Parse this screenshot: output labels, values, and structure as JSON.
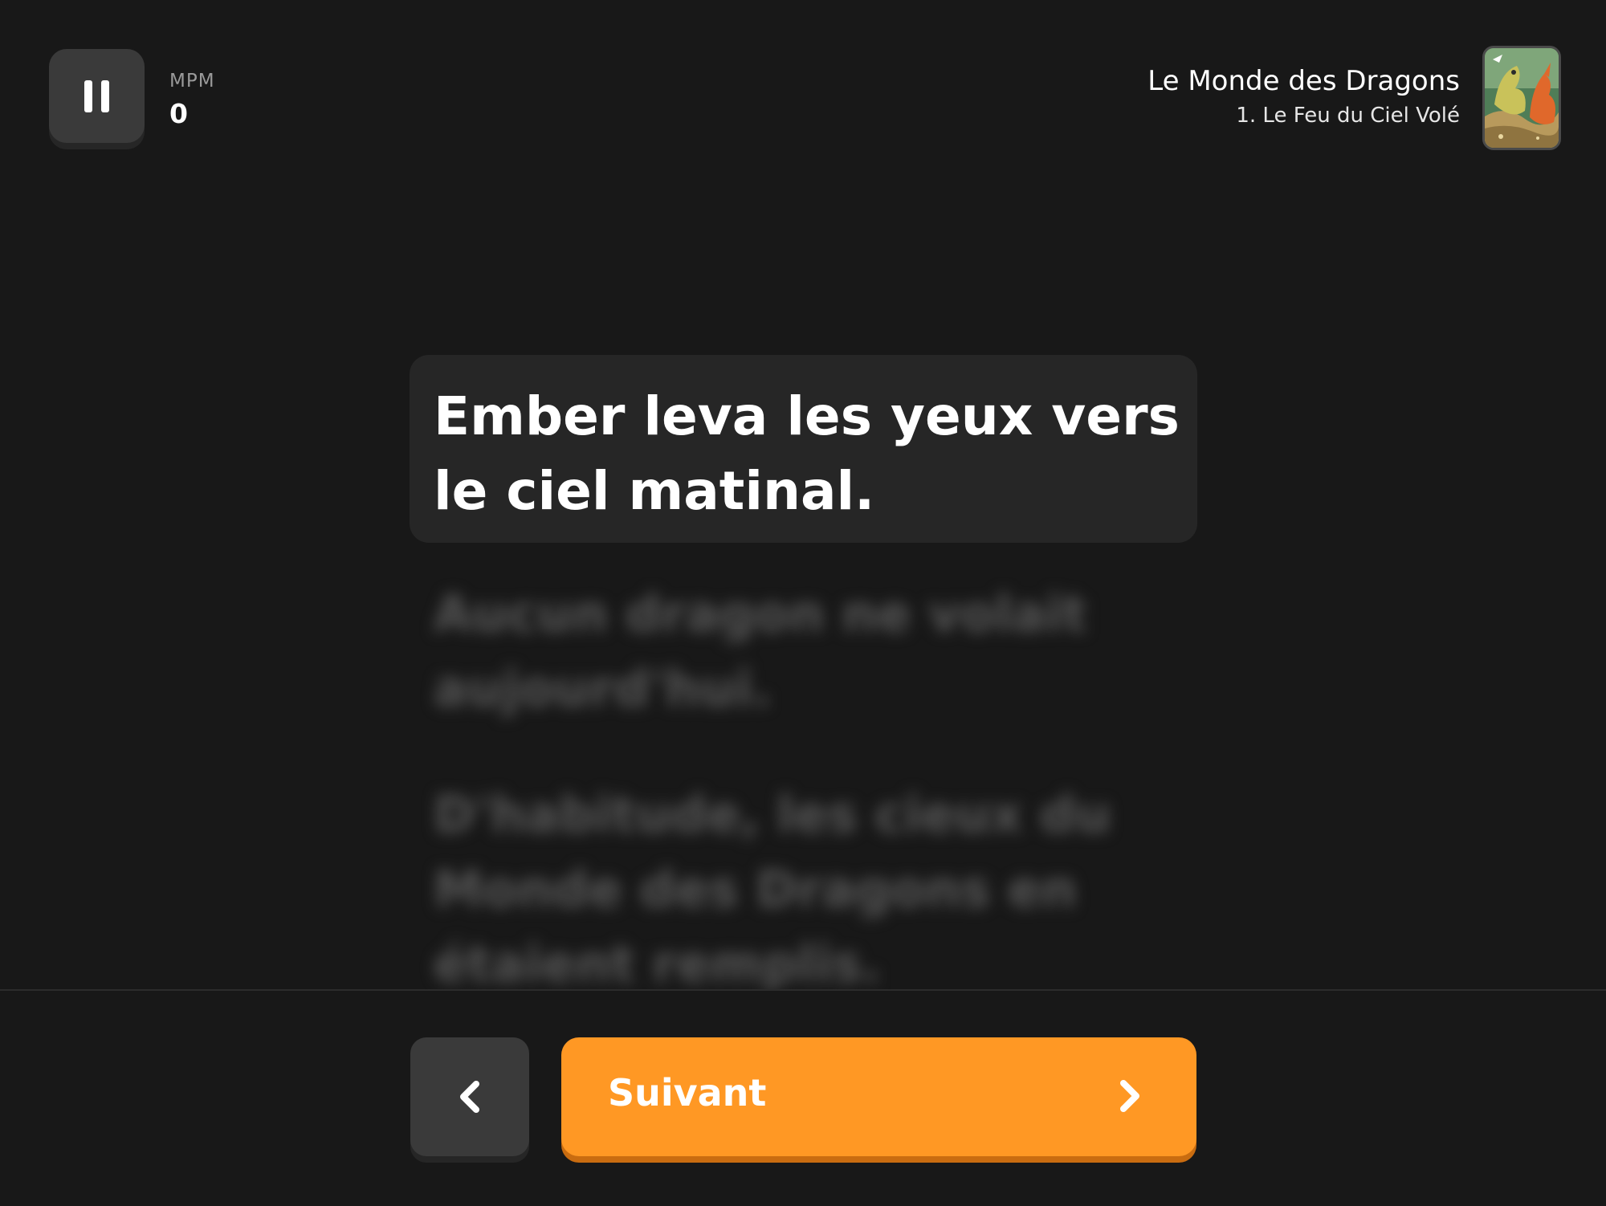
{
  "header": {
    "pause_icon": "pause-icon",
    "wpm_label": "MPM",
    "wpm_value": "0"
  },
  "book": {
    "title": "Le Monde des Dragons",
    "chapter": "1. Le Feu du Ciel Volé",
    "cover_icon": "book-cover-dragons"
  },
  "reading": {
    "current_sentence": "Ember leva les yeux vers le ciel matinal.",
    "upcoming_sentences": [
      "Aucun dragon ne volait aujourd'hui.",
      "D'habitude, les cieux du Monde des Dragons en étaient remplis."
    ]
  },
  "navigation": {
    "previous_icon": "chevron-left-icon",
    "next_label": "Suivant",
    "next_icon": "chevron-right-icon"
  },
  "colors": {
    "background": "#181818",
    "card": "#262626",
    "button_dark": "#3a3a3a",
    "accent": "#ff9824"
  }
}
